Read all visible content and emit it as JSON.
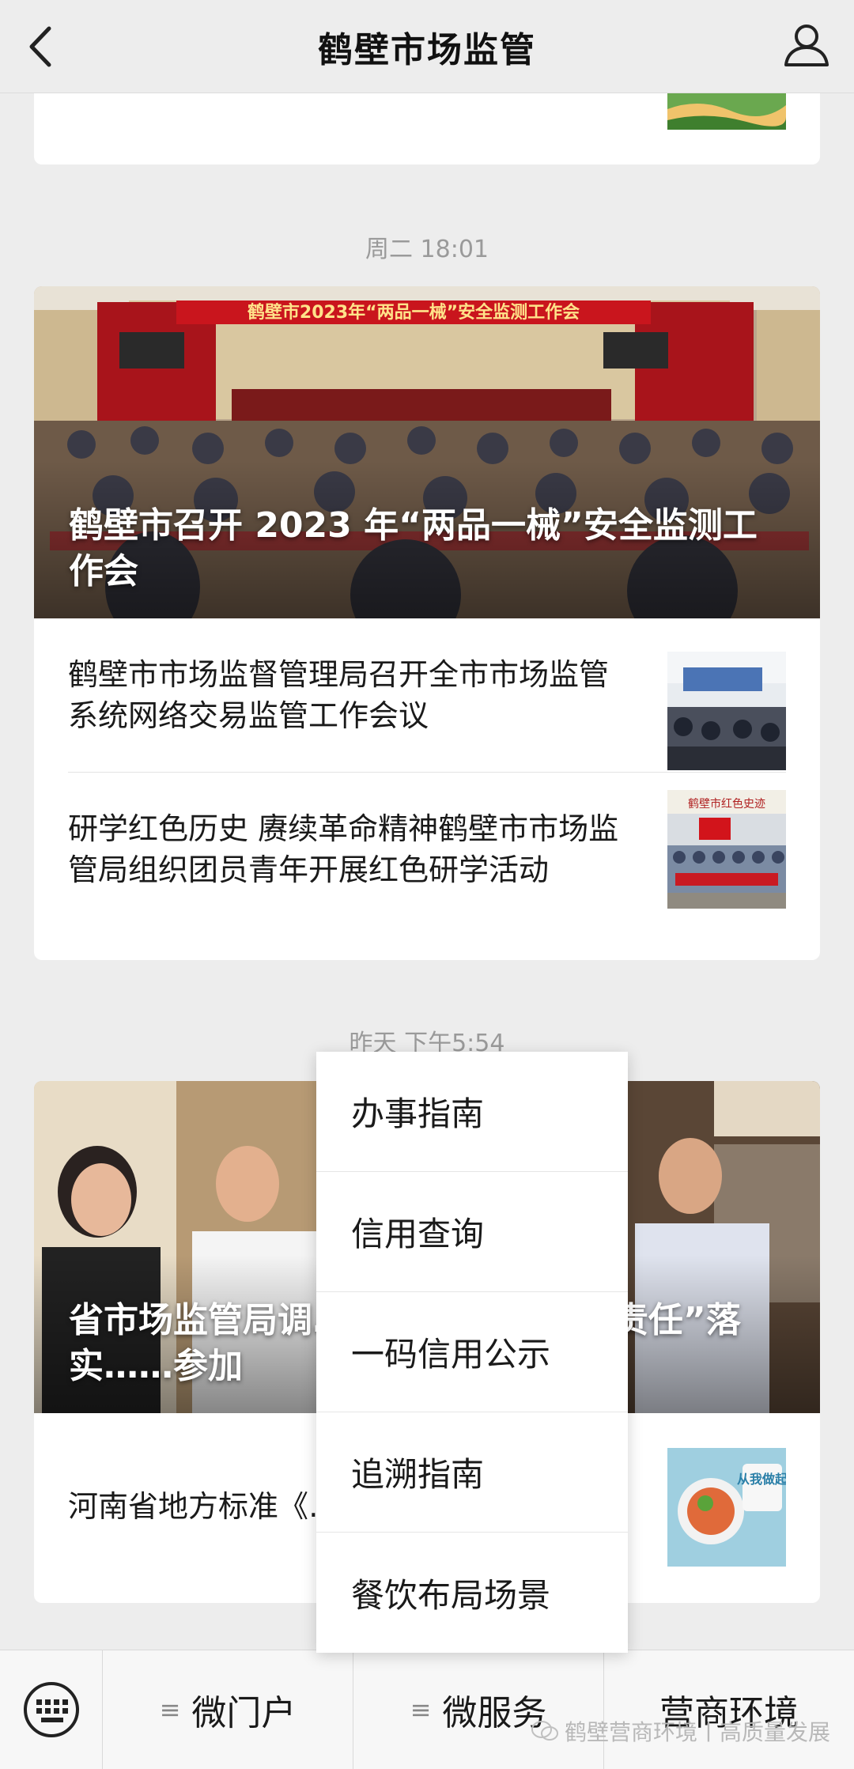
{
  "header": {
    "title": "鹤壁市场监管"
  },
  "groups": [
    {
      "time": "周二 18:01",
      "cover": {
        "banner_text": "鹤壁市2023年“两品一械”安全监测工作会",
        "title": "鹤壁市召开 2023 年“两品一械”安全监测工作会"
      },
      "items": [
        {
          "title": "鹤壁市市场监督管理局召开全市市场监管系统网络交易监管工作会议"
        },
        {
          "title": "研学红色历史 赓续革命精神鹤壁市市场监管局组织团员青年开展红色研学活动",
          "thumb_text": "鹤壁市红色史迹"
        }
      ]
    },
    {
      "time": "昨天 下午5:54",
      "cover": {
        "title": "省市场监管局调……食品安全“两个责任”落实……参加"
      },
      "items": [
        {
          "title": "河南省地方标准《……理规范》解读",
          "thumb_text": "从我做起"
        }
      ]
    }
  ],
  "popup_menu": [
    "办事指南",
    "信用查询",
    "一码信用公示",
    "追溯指南",
    "餐饮布局场景"
  ],
  "bottom_tabs": [
    "微门户",
    "微服务",
    "营商环境"
  ],
  "watermark": "鹤壁营商环境丨高质量发展"
}
